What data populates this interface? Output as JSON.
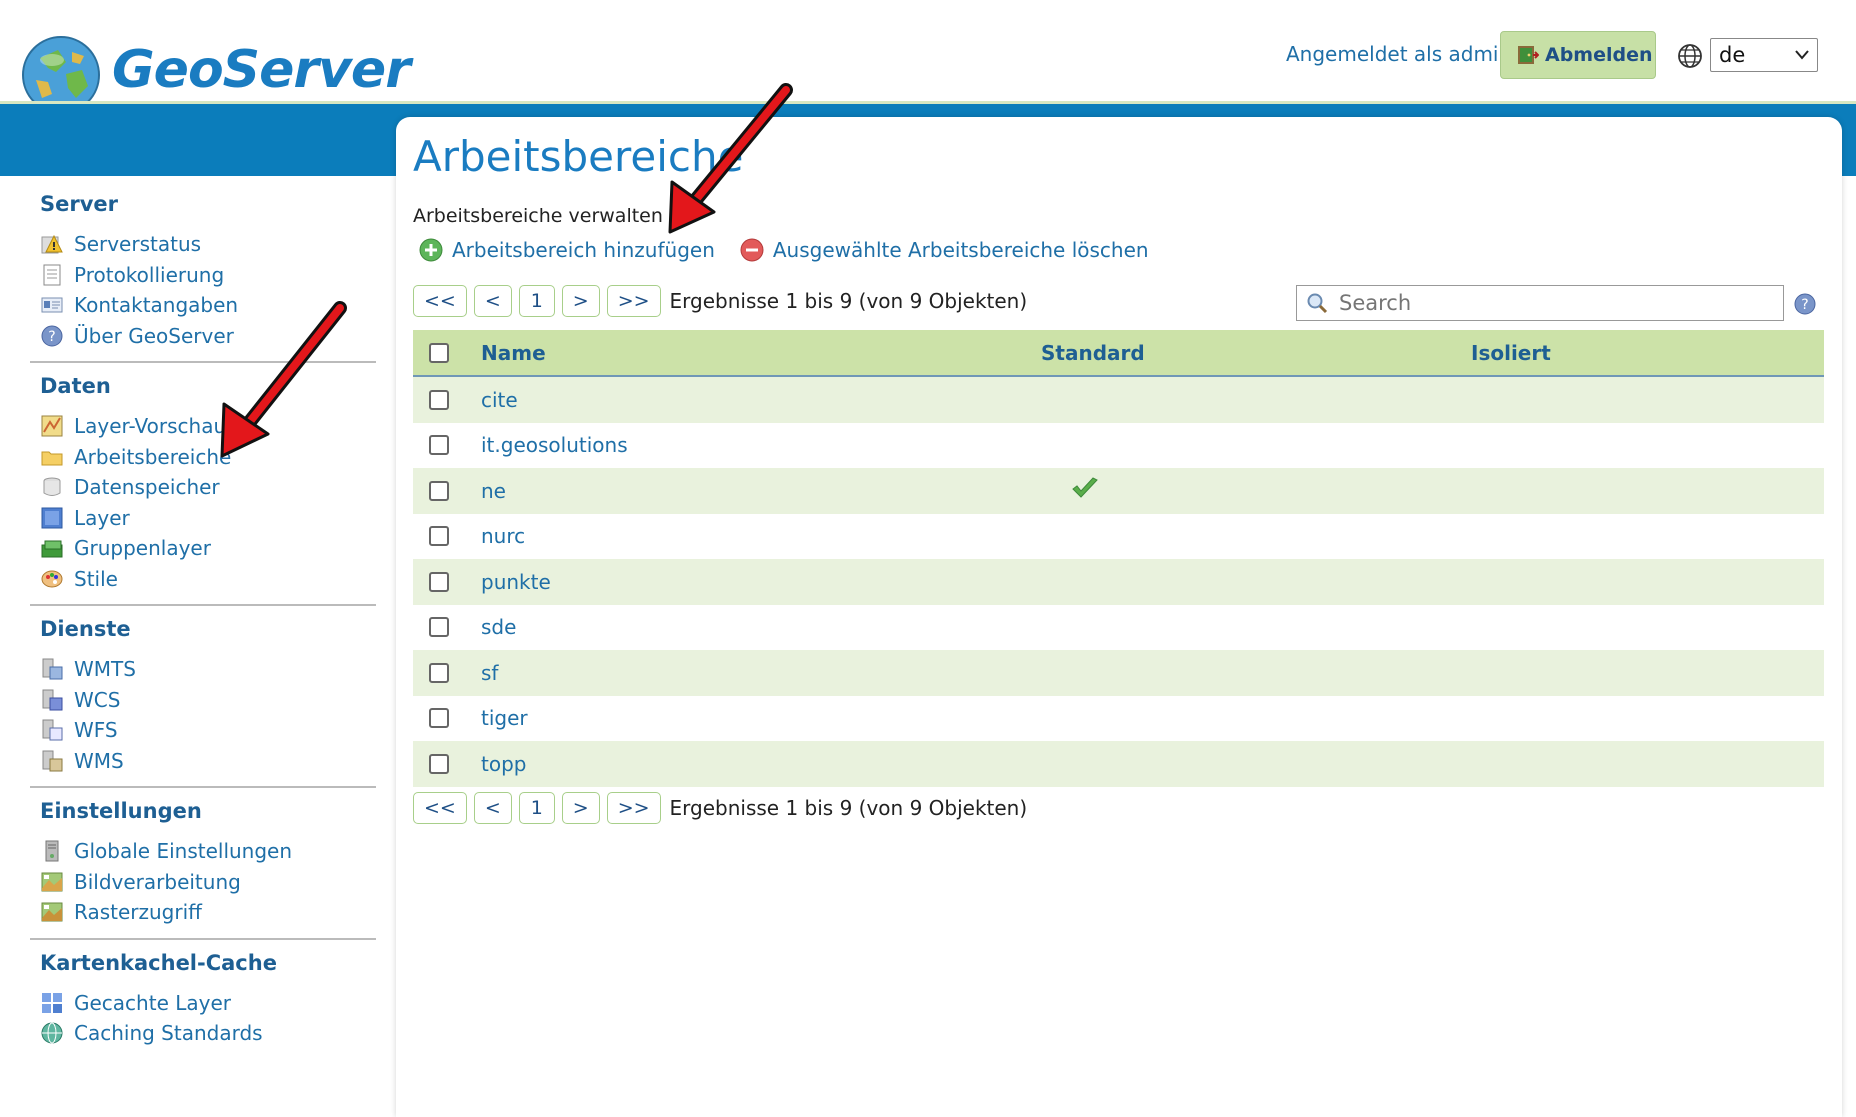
{
  "header": {
    "logo_text": "GeoServer",
    "login_text": "Angemeldet als admin.",
    "logout_label": "Abmelden",
    "language_value": "de"
  },
  "sidebar": {
    "sections": [
      {
        "title": "Server",
        "items": [
          {
            "label": "Serverstatus",
            "icon": "warning-status-icon"
          },
          {
            "label": "Protokollierung",
            "icon": "document-icon"
          },
          {
            "label": "Kontaktangaben",
            "icon": "contact-card-icon"
          },
          {
            "label": "Über GeoServer",
            "icon": "about-icon"
          }
        ]
      },
      {
        "title": "Daten",
        "items": [
          {
            "label": "Layer-Vorschau",
            "icon": "map-preview-icon"
          },
          {
            "label": "Arbeitsbereiche",
            "icon": "folder-icon"
          },
          {
            "label": "Datenspeicher",
            "icon": "database-icon"
          },
          {
            "label": "Layer",
            "icon": "layer-icon"
          },
          {
            "label": "Gruppenlayer",
            "icon": "layer-group-icon"
          },
          {
            "label": "Stile",
            "icon": "palette-icon"
          }
        ]
      },
      {
        "title": "Dienste",
        "items": [
          {
            "label": "WMTS",
            "icon": "service-icon"
          },
          {
            "label": "WCS",
            "icon": "service-icon"
          },
          {
            "label": "WFS",
            "icon": "service-icon"
          },
          {
            "label": "WMS",
            "icon": "service-icon"
          }
        ]
      },
      {
        "title": "Einstellungen",
        "items": [
          {
            "label": "Globale Einstellungen",
            "icon": "server-settings-icon"
          },
          {
            "label": "Bildverarbeitung",
            "icon": "image-processing-icon"
          },
          {
            "label": "Rasterzugriff",
            "icon": "raster-access-icon"
          }
        ]
      },
      {
        "title": "Kartenkachel-Cache",
        "items": [
          {
            "label": "Gecachte Layer",
            "icon": "tile-grid-icon"
          },
          {
            "label": "Caching Standards",
            "icon": "globe-icon"
          }
        ]
      }
    ]
  },
  "main": {
    "title": "Arbeitsbereiche",
    "subtitle": "Arbeitsbereiche verwalten",
    "add_label": "Arbeitsbereich hinzufügen",
    "delete_label": "Ausgewählte Arbeitsbereiche löschen",
    "pager": {
      "first": "<<",
      "prev": "<",
      "page": "1",
      "next": ">",
      "last": ">>",
      "info": "Ergebnisse 1 bis 9 (von 9 Objekten)"
    },
    "search_placeholder": "Search",
    "table": {
      "headers": {
        "name": "Name",
        "standard": "Standard",
        "isolated": "Isoliert"
      },
      "rows": [
        {
          "name": "cite",
          "standard": false
        },
        {
          "name": "it.geosolutions",
          "standard": false
        },
        {
          "name": "ne",
          "standard": true
        },
        {
          "name": "nurc",
          "standard": false
        },
        {
          "name": "punkte",
          "standard": false
        },
        {
          "name": "sde",
          "standard": false
        },
        {
          "name": "sf",
          "standard": false
        },
        {
          "name": "tiger",
          "standard": false
        },
        {
          "name": "topp",
          "standard": false
        }
      ]
    }
  },
  "colors": {
    "brand_blue": "#0b7dbb",
    "header_green": "#cce2a8",
    "row_alt": "#e9f2dd",
    "annotation_arrow": "#e3171b"
  }
}
